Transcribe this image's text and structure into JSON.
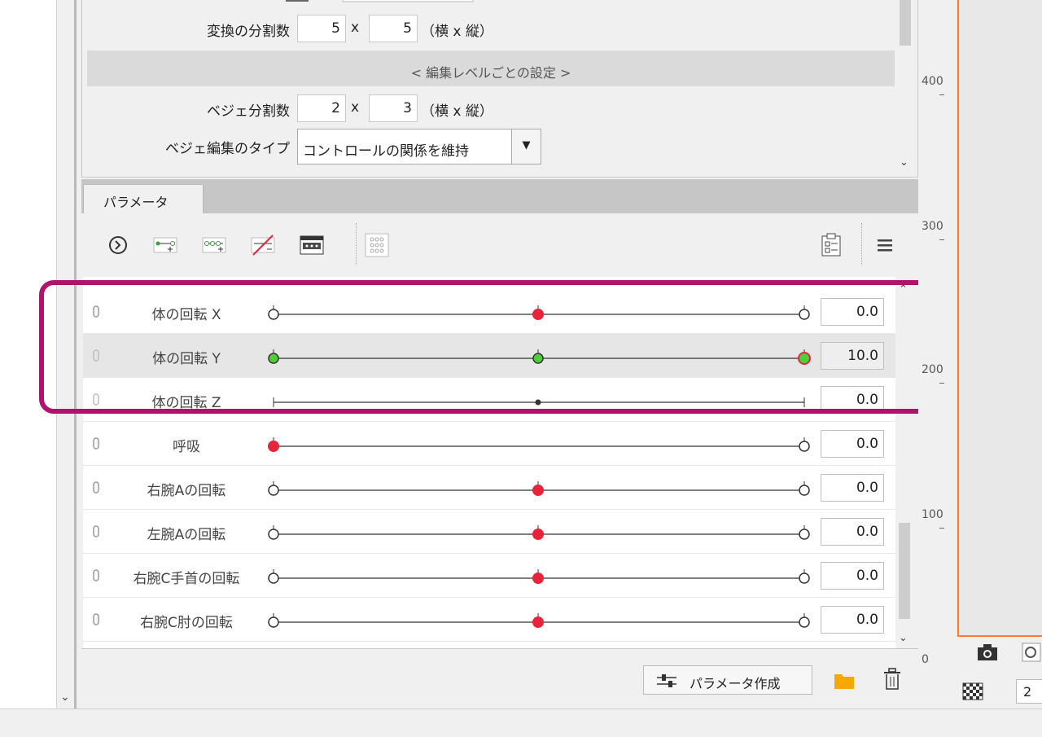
{
  "deform": {
    "split_label": "変換の分割数",
    "split_x": "5",
    "split_y": "5",
    "x_symbol": "x",
    "split_unit": "（横 x 縦）",
    "section_title": "< 編集レベルごとの設定 >",
    "bezier_label": "ベジェ分割数",
    "bezier_x": "2",
    "bezier_y": "3",
    "bezier_unit": "（横 x 縦）",
    "bezier_type_label": "ベジェ編集のタイプ",
    "bezier_type_value": "コントロールの関係を維持"
  },
  "tabs": {
    "parameter": "パラメータ"
  },
  "toolbar": {
    "icons": [
      "expand-icon",
      "add-key-icon",
      "add-3-keys-icon",
      "delete-key-icon",
      "key-editor-icon",
      "grid-keys-icon",
      "clipboard-icon",
      "menu-icon"
    ]
  },
  "parameters": [
    {
      "name": "体の回転 X",
      "value": "0.0"
    },
    {
      "name": "体の回転 Y",
      "value": "10.0"
    },
    {
      "name": "体の回転 Z",
      "value": "0.0"
    },
    {
      "name": "呼吸",
      "value": "0.0"
    },
    {
      "name": "右腕Aの回転",
      "value": "0.0"
    },
    {
      "name": "左腕Aの回転",
      "value": "0.0"
    },
    {
      "name": "右腕C手首の回転",
      "value": "0.0"
    },
    {
      "name": "右腕C肘の回転",
      "value": "0.0"
    }
  ],
  "bottom": {
    "create_param": "パラメータ作成"
  },
  "ruler": {
    "labels": [
      "400",
      "300",
      "200",
      "100",
      "0"
    ]
  },
  "canvas": {
    "zoom": "2"
  },
  "colors": {
    "highlight": "#b0126c",
    "key_red": "#e8243c",
    "key_green": "#4ecf3a",
    "canvas_border": "#ff7a2a"
  }
}
